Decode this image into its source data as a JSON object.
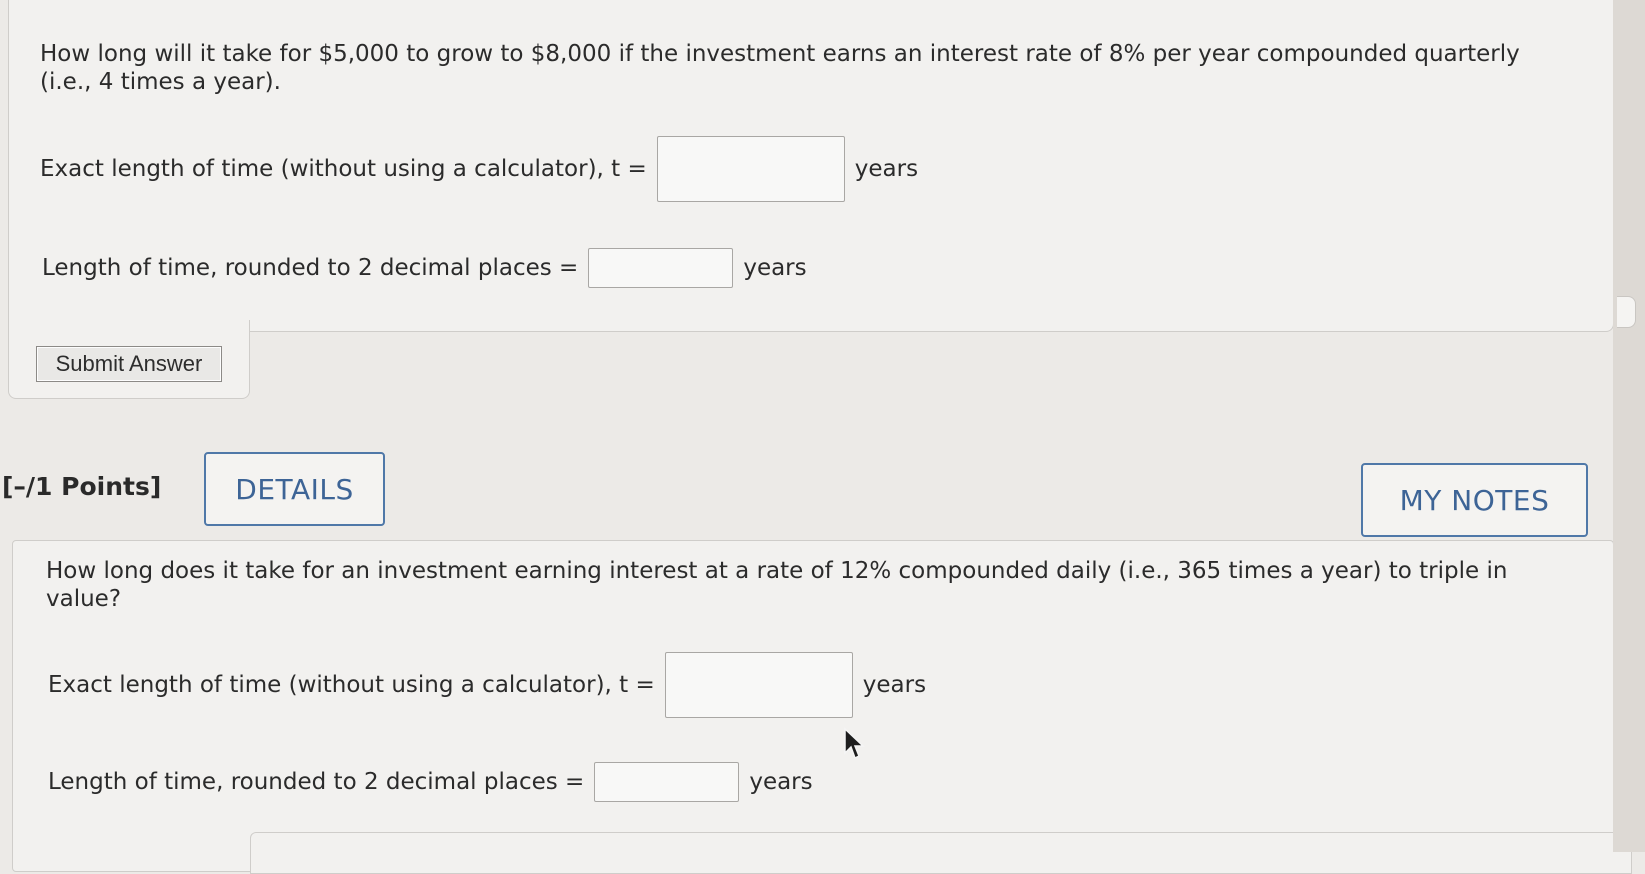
{
  "question1": {
    "prompt": "How long will it take for $5,000 to grow to $8,000 if the investment earns an interest rate of 8% per year compounded quarterly (i.e., 4 times a year).",
    "exact_label": "Exact length of time (without using a calculator), t =",
    "exact_value": "",
    "exact_unit": "years",
    "rounded_label": "Length of time, rounded to 2 decimal places =",
    "rounded_value": "",
    "rounded_unit": "years",
    "submit_label": "Submit Answer"
  },
  "question2": {
    "points": "[–/1 Points]",
    "details_label": "DETAILS",
    "my_notes_label": "MY NOTES",
    "prompt": "How long does it take for an investment earning interest at a rate of 12% compounded daily (i.e., 365 times a year) to triple in value?",
    "exact_label": "Exact length of time (without using a calculator), t =",
    "exact_value": "",
    "exact_unit": "years",
    "rounded_label": "Length of time, rounded to 2 decimal places =",
    "rounded_value": "",
    "rounded_unit": "years"
  },
  "colors": {
    "accent": "#4f78a8",
    "background": "#eceae7",
    "panel": "#f2f1ef"
  },
  "icons": {
    "cursor": "mouse-pointer-icon"
  }
}
